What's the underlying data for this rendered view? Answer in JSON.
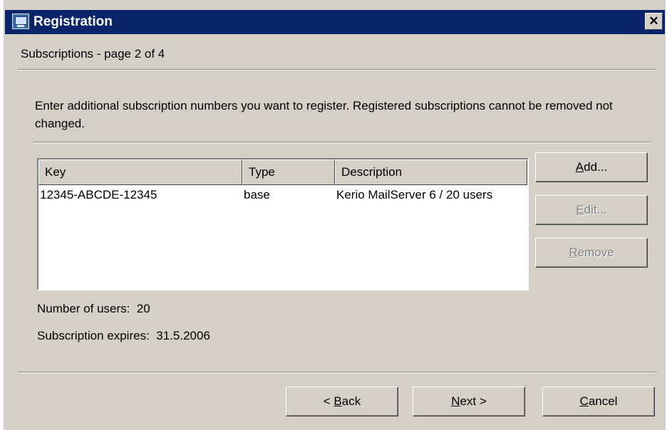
{
  "window": {
    "title": "Registration",
    "close_glyph": "✕"
  },
  "page": {
    "title": "Subscriptions - page 2 of 4"
  },
  "instructions": "Enter additional subscription numbers you want to register. Registered subscriptions cannot be removed not changed.",
  "list": {
    "columns": [
      "Key",
      "Type",
      "Description"
    ],
    "rows": [
      {
        "key": "12345-ABCDE-12345",
        "type": "base",
        "description": "Kerio MailServer 6 / 20 users"
      }
    ]
  },
  "side_buttons": {
    "add": {
      "accel": "A",
      "rest": "dd...",
      "enabled": true
    },
    "edit": {
      "accel": "E",
      "rest": "dit...",
      "enabled": false
    },
    "remove": {
      "accel": "R",
      "rest": "emove",
      "enabled": false
    }
  },
  "info": {
    "users_label": "Number of users:",
    "users_value": "20",
    "expires_label": "Subscription expires:",
    "expires_value": "31.5.2006"
  },
  "nav_buttons": {
    "back": {
      "prefix": "< ",
      "accel": "B",
      "rest": "ack"
    },
    "next": {
      "accel": "N",
      "rest": "ext >"
    },
    "cancel": {
      "accel": "C",
      "rest": "ancel"
    }
  },
  "icons": {
    "app": "registration-app-icon",
    "close": "close-icon"
  },
  "colors": {
    "titlebar": "#0a246a",
    "face": "#d4d0c8",
    "disabled_text": "#808080"
  }
}
